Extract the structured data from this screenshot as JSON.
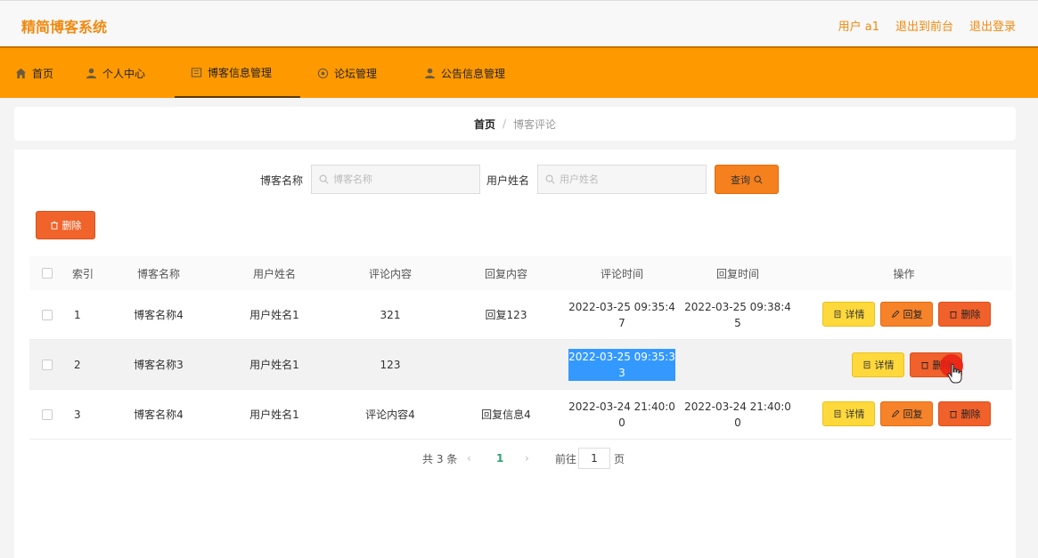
{
  "header": {
    "title": "精简博客系统",
    "user_label": "用户 a1",
    "exit_front": "退出到前台",
    "logout": "退出登录"
  },
  "nav": {
    "items": [
      {
        "label": "首页",
        "icon": "home-icon"
      },
      {
        "label": "个人中心",
        "icon": "user-icon"
      },
      {
        "label": "博客信息管理",
        "icon": "blog-icon"
      },
      {
        "label": "论坛管理",
        "icon": "forum-icon"
      },
      {
        "label": "公告信息管理",
        "icon": "notice-icon"
      }
    ],
    "active_index": 2
  },
  "breadcrumb": {
    "home": "首页",
    "separator": "/",
    "current": "博客评论"
  },
  "search": {
    "blog_name_label": "博客名称",
    "blog_name_placeholder": "博客名称",
    "blog_name_value": "",
    "user_name_label": "用户姓名",
    "user_name_placeholder": "用户姓名",
    "user_name_value": "",
    "query_label": "查询"
  },
  "toolbar": {
    "delete_label": "删除"
  },
  "table": {
    "headers": [
      "索引",
      "博客名称",
      "用户姓名",
      "评论内容",
      "回复内容",
      "评论时间",
      "回复时间",
      "操作"
    ],
    "rows": [
      {
        "index": "1",
        "blog": "博客名称4",
        "user": "用户姓名1",
        "comment": "321",
        "reply": "回复123",
        "comment_time": "2022-03-25 09:35:47",
        "reply_time": "2022-03-25 09:38:45"
      },
      {
        "index": "2",
        "blog": "博客名称3",
        "user": "用户姓名1",
        "comment": "123",
        "reply": "",
        "comment_time": "2022-03-25 09:35:33",
        "reply_time": ""
      },
      {
        "index": "3",
        "blog": "博客名称4",
        "user": "用户姓名1",
        "comment": "评论内容4",
        "reply": "回复信息4",
        "comment_time": "2022-03-24 21:40:00",
        "reply_time": "2022-03-24 21:40:00"
      }
    ],
    "op_detail": "详情",
    "op_reply": "回复",
    "op_delete": "删除"
  },
  "pager": {
    "total": "共 3 条",
    "current_page": "1",
    "goto_label": "前往",
    "goto_value": "1",
    "page_suffix": "页"
  },
  "colors": {
    "accent": "#ff9900",
    "title": "#f08a11",
    "detail": "#ffd93b",
    "reply": "#f6832a",
    "delete": "#f0612b"
  }
}
